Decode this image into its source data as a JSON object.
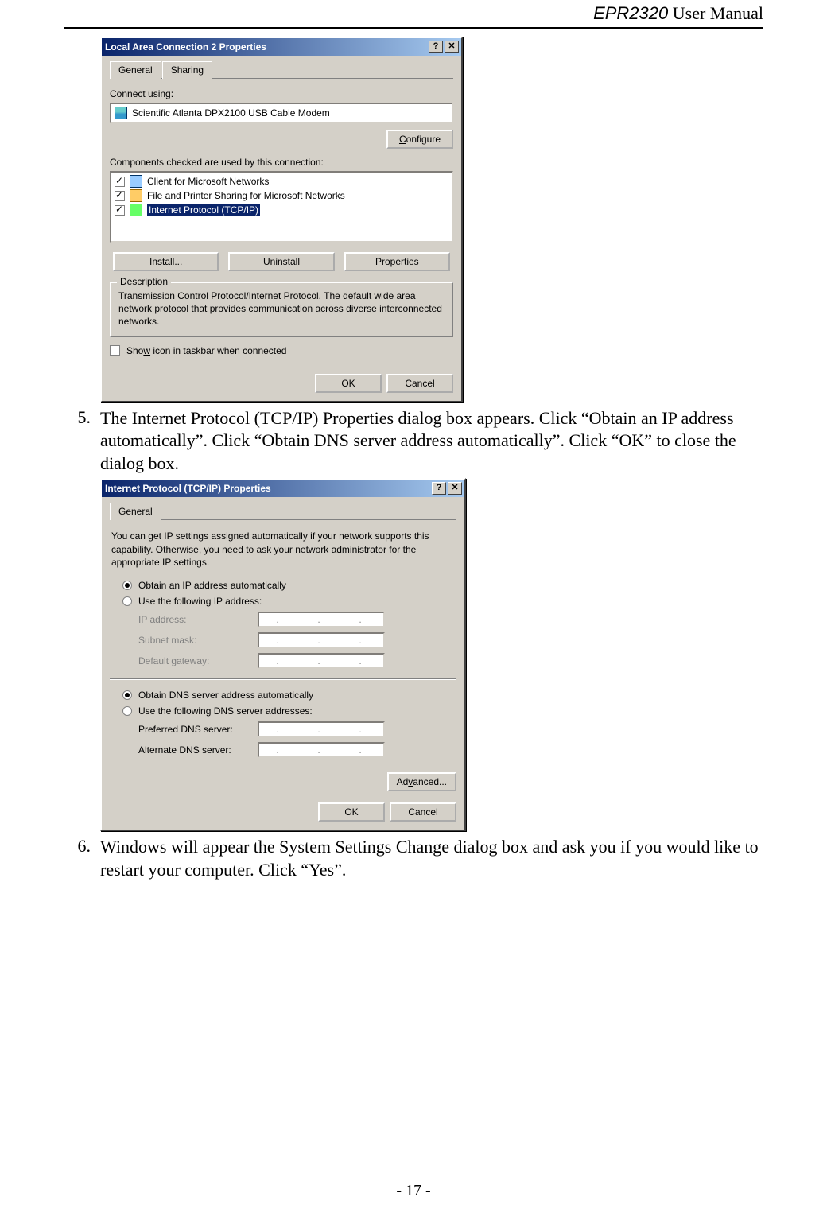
{
  "header": {
    "product": "EPR2320",
    "suffix": " User Manual"
  },
  "footer": {
    "page_label": "- 17 -"
  },
  "steps": {
    "five": {
      "num": "5.",
      "text": "The Internet Protocol (TCP/IP) Properties dialog box appears. Click “Obtain an IP address automatically”. Click “Obtain DNS server address automatically”. Click “OK” to close the dialog box."
    },
    "six": {
      "num": "6.",
      "text": "Windows will appear the System Settings Change dialog box and ask you if you would like to restart your computer. Click “Yes”."
    }
  },
  "dlg1": {
    "title": "Local Area Connection 2 Properties",
    "help_btn": "?",
    "close_btn": "✕",
    "tabs": {
      "general": "General",
      "sharing": "Sharing"
    },
    "connect_using_label": "Connect using:",
    "adapter": "Scientific Atlanta DPX2100 USB Cable Modem",
    "configure_btn": "Configure",
    "components_label": "Components checked are used by this connection:",
    "components": [
      {
        "checked": true,
        "selected": false,
        "icon": "ic-monitor",
        "label": "Client for Microsoft Networks"
      },
      {
        "checked": true,
        "selected": false,
        "icon": "ic-share",
        "label": "File and Printer Sharing for Microsoft Networks"
      },
      {
        "checked": true,
        "selected": true,
        "icon": "ic-tcp",
        "label": "Internet Protocol (TCP/IP)"
      }
    ],
    "install_btn": "Install...",
    "uninstall_btn": "Uninstall",
    "properties_btn": "Properties",
    "description_legend": "Description",
    "description_text": "Transmission Control Protocol/Internet Protocol. The default wide area network protocol that provides communication across diverse interconnected networks.",
    "show_icon_label": "Show icon in taskbar when connected",
    "ok_btn": "OK",
    "cancel_btn": "Cancel"
  },
  "dlg2": {
    "title": "Internet Protocol (TCP/IP) Properties",
    "help_btn": "?",
    "close_btn": "✕",
    "tab_general": "General",
    "info_text": "You can get IP settings assigned automatically if your network supports this capability. Otherwise, you need to ask your network administrator for the appropriate IP settings.",
    "radio_obtain_ip": "Obtain an IP address automatically",
    "radio_use_ip": "Use the following IP address:",
    "ip_address_label": "IP address:",
    "subnet_label": "Subnet mask:",
    "gateway_label": "Default gateway:",
    "radio_obtain_dns": "Obtain DNS server address automatically",
    "radio_use_dns": "Use the following DNS server addresses:",
    "pref_dns_label": "Preferred DNS server:",
    "alt_dns_label": "Alternate DNS server:",
    "advanced_btn": "Advanced...",
    "ok_btn": "OK",
    "cancel_btn": "Cancel"
  }
}
